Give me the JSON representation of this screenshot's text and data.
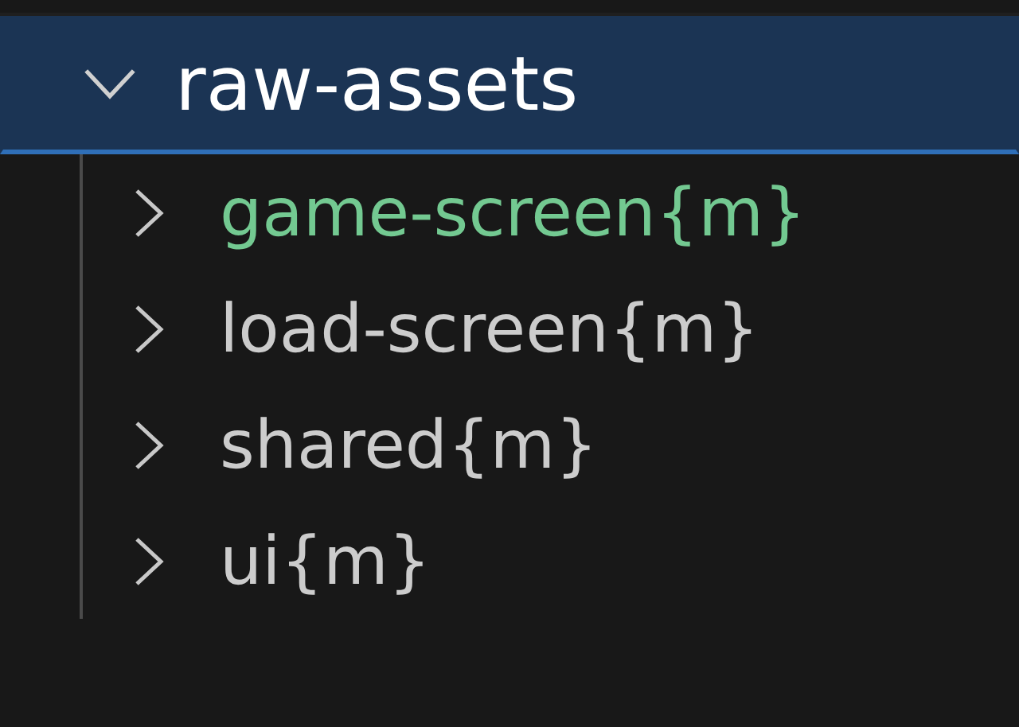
{
  "explorer": {
    "tree": [
      {
        "label": "raw-assets",
        "expanded": true,
        "selected": true,
        "color": "#ffffff",
        "children": [
          {
            "label": "game-screen{m}",
            "expanded": false,
            "selected": false,
            "color": "#73c991"
          },
          {
            "label": "load-screen{m}",
            "expanded": false,
            "selected": false,
            "color": "#cccccc"
          },
          {
            "label": "shared{m}",
            "expanded": false,
            "selected": false,
            "color": "#cccccc"
          },
          {
            "label": "ui{m}",
            "expanded": false,
            "selected": false,
            "color": "#cccccc"
          }
        ]
      }
    ]
  }
}
